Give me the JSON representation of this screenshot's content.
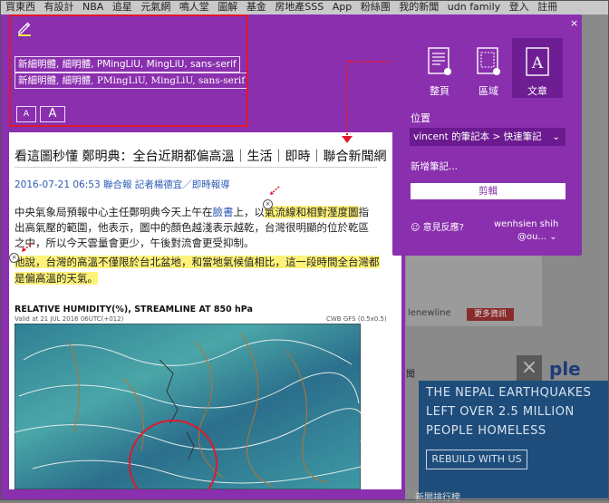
{
  "site_nav": [
    "買東西",
    "有設計",
    "NBA",
    "追星",
    "元氣網",
    "鳴人堂",
    "圖解",
    "基金",
    "房地產SSS",
    "App",
    "粉絲團",
    "我的新聞",
    "udn family",
    "登入",
    "註冊"
  ],
  "toolbar": {
    "font_option_1": "新細明體, 細明體, PMingLiU, MingLiU, sans-serif",
    "font_option_2": "新細明體, 細明體, PMingLiU, MingLiU, sans-serif",
    "size_small": "A",
    "size_large": "A"
  },
  "article": {
    "title": "看這圖秒懂 鄭明典：全台近期都偏高溫｜生活｜即時｜聯合新聞網",
    "meta": "2016-07-21 06:53 聯合報 記者楊德宜／即時報導",
    "p1_a": "中央氣象局預報中心主任鄭明典今天上午在",
    "p1_link": "臉書",
    "p1_b": "上，以",
    "p1_hl": "氣流線和相對溼度圖",
    "p1_c": "指出高氣壓的範圍，他表示，圖中的顏色越淺表示越乾，台灣很明顯的位於乾區之中，所以今天雲量會更少，午後對流會更受抑制。",
    "p2_hl": "他說，台灣的高溫不僅限於台北盆地，和當地氣候值相比，這一段時間全台灣都是偏高溫的天氣。",
    "map_title": "RELATIVE HUMIDITY(%), STREAMLINE AT 850 hPa",
    "map_valid": "Valid at 21 JUL 2016 06UTC(+012)",
    "map_source": "CWB GFS  (0.5x0.5)"
  },
  "clipper": {
    "close": "×",
    "options": [
      {
        "label": "整頁",
        "icon": "full-page-icon"
      },
      {
        "label": "區域",
        "icon": "region-icon"
      },
      {
        "label": "文章",
        "icon": "article-icon",
        "selected": true
      }
    ],
    "location_label": "位置",
    "notebook": "vincent 的筆記本 > 快速筆記",
    "new_note": "新增筆記...",
    "clip_button": "剪輯",
    "feedback": "意見反應?",
    "user_line1": "wenhsien shih",
    "user_line2": "@ou..."
  },
  "background": {
    "ad_more": "更多資訊",
    "ad_link": "lenewline",
    "ple": "ple",
    "side_text": "聞",
    "banner": [
      "THE NEPAL EARTHQUAKES",
      "LEFT OVER 2.5 MILLION",
      "PEOPLE HOMELESS"
    ],
    "banner_button": "REBUILD WITH US",
    "bottom_text": "新聞排行榜"
  },
  "colors": {
    "evernote_purple": "#8a2fae",
    "highlight": "#fff27a",
    "annotation_red": "#e0182d"
  }
}
